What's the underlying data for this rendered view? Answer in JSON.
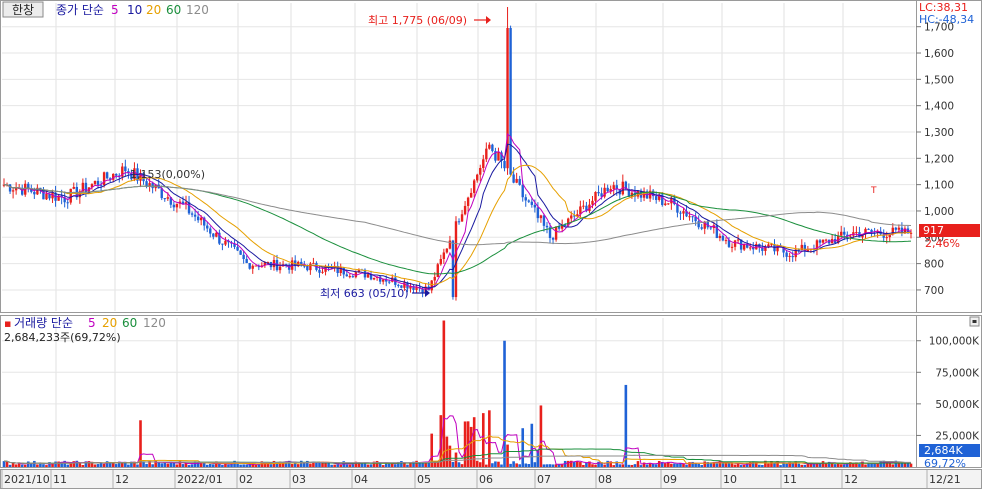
{
  "header": {
    "symbol": "한창",
    "price_legend": {
      "label": "종가 단순",
      "periods": [
        "5",
        "10",
        "20",
        "60",
        "120"
      ],
      "colors": [
        "#c000c0",
        "#1a1aa0",
        "#e6a000",
        "#1a8f3c",
        "#8c8c8c"
      ]
    },
    "lc": "LC:38,31",
    "hc": "HC:-48,34"
  },
  "volume_legend": {
    "label": "거래량 단순",
    "periods": [
      "5",
      "20",
      "60",
      "120"
    ],
    "colors": [
      "#c000c0",
      "#e6a000",
      "#1a8f3c",
      "#8c8c8c"
    ],
    "current": "2,684,233주(69,72%)"
  },
  "annotations": {
    "high": "최고 1,775 (06/09)",
    "low": "최저 663 (05/10)",
    "mid": "1,153(0,00%)",
    "tag": "T"
  },
  "price_badge": {
    "value": "917",
    "change": "2,46%"
  },
  "volume_badge": {
    "value": "2,684K",
    "pct": "69,72%"
  },
  "x_axis_labels": [
    "2021/10",
    "11",
    "12",
    "2022/01",
    "02",
    "03",
    "04",
    "05",
    "06",
    "07",
    "08",
    "09",
    "10",
    "11",
    "12",
    "12/21"
  ],
  "colors": {
    "up": "#e8201c",
    "down": "#1f62d6",
    "badge": "#e8201c",
    "volume_badge": "#1f62d6"
  },
  "chart_data": [
    {
      "type": "candlestick",
      "name": "price",
      "y_ticks": [
        "1,700",
        "1,600",
        "1,500",
        "1,400",
        "1,300",
        "1,200",
        "1,100",
        "1,000",
        "900",
        "800",
        "700"
      ],
      "ylim": [
        620,
        1790
      ],
      "months": [
        "2021/10",
        "11",
        "12",
        "2022/01",
        "02",
        "03",
        "04",
        "05",
        "06",
        "07",
        "08",
        "09",
        "10",
        "11",
        "12"
      ],
      "close_by_month": [
        1100,
        1050,
        1160,
        1010,
        800,
        790,
        760,
        700,
        1250,
        900,
        1100,
        1030,
        880,
        840,
        917
      ],
      "high": {
        "value": 1775,
        "date": "06/09"
      },
      "low": {
        "value": 663,
        "date": "05/10"
      },
      "last_close": 917,
      "last_change_pct": 2.46,
      "moving_averages": [
        "5",
        "10",
        "20",
        "60",
        "120"
      ]
    },
    {
      "type": "bar",
      "name": "volume",
      "y_ticks": [
        "100,000K",
        "75,000K",
        "50,000K",
        "25,000K"
      ],
      "ylim": [
        0,
        118000
      ],
      "unit": "K",
      "spikes": [
        {
          "month": "05",
          "value": 116000
        },
        {
          "month": "06",
          "value": 100000
        },
        {
          "month": "08",
          "value": 65000
        },
        {
          "month": "12",
          "value": 37000
        }
      ],
      "last_value": 2684,
      "last_value_pct": 69.72
    }
  ]
}
